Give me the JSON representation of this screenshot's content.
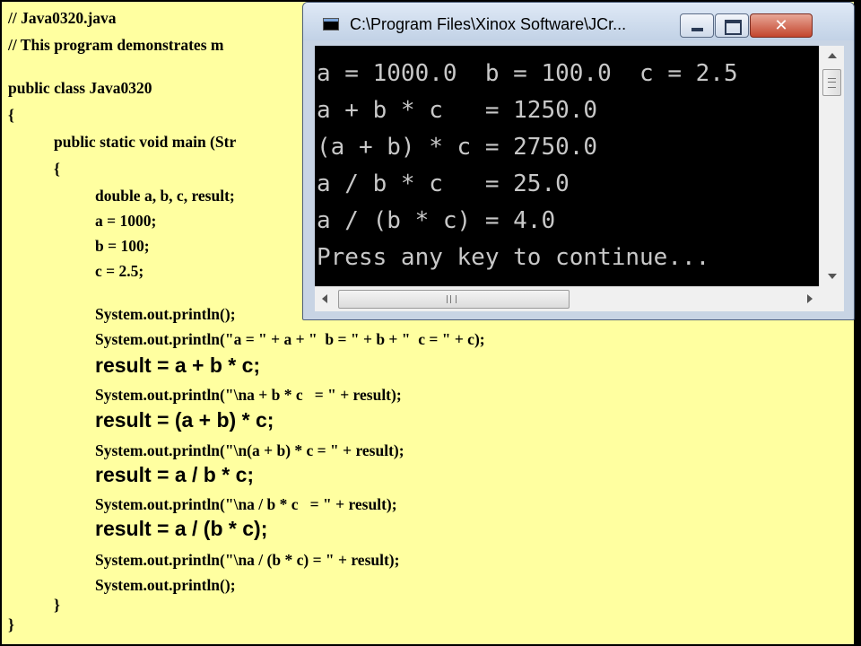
{
  "code": {
    "comment1": "// Java0320.java",
    "comment2": "// This program demonstrates m",
    "class_decl": "public class Java0320",
    "class_open": "{",
    "main_decl": "public static void main (Str",
    "main_open": "{",
    "decl": "double a, b, c, result;",
    "assign_a": "a = 1000;",
    "assign_b": "b = 100;",
    "assign_c": "c = 2.5;",
    "println_empty1": "System.out.println();",
    "println_abc": "System.out.println(\"a = \" + a + \"  b = \" + b + \"  c = \" + c);",
    "result1": "result = a + b * c;",
    "println1": "System.out.println(\"\\na + b * c   = \" + result);",
    "result2": "result = (a + b) * c;",
    "println2": "System.out.println(\"\\n(a + b) * c = \" + result);",
    "result3": "result = a / b * c;",
    "println3": "System.out.println(\"\\na / b * c   = \" + result);",
    "result4": "result = a / (b * c);",
    "println4": "System.out.println(\"\\na / (b * c) = \" + result);",
    "println_empty2": "System.out.println();",
    "main_close": "}",
    "class_close": "}"
  },
  "console": {
    "title": "C:\\Program Files\\Xinox Software\\JCr...",
    "lines": [
      "a = 1000.0  b = 100.0  c = 2.5",
      "a + b * c   = 1250.0",
      "(a + b) * c = 2750.0",
      "a / b * c   = 25.0",
      "a / (b * c) = 4.0",
      "Press any key to continue..."
    ],
    "text_color": "#c8c8c8",
    "background": "#000000"
  },
  "colors": {
    "slide_background": "#ffffa0",
    "close_button": "#c3452d"
  }
}
